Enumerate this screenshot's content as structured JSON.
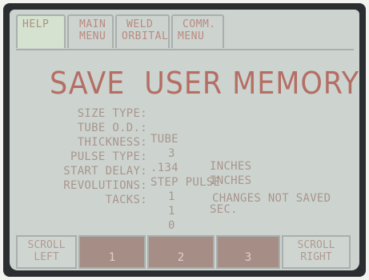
{
  "top_softkeys": [
    {
      "line1": "HELP",
      "line2": ""
    },
    {
      "line1": "MAIN",
      "line2": "MENU"
    },
    {
      "line1": "WELD",
      "line2": "ORBITAL"
    },
    {
      "line1": "COMM.",
      "line2": "MENU"
    }
  ],
  "title": "SAVE  USER MEMORY",
  "parameters": [
    {
      "label": "SIZE TYPE:",
      "value": "TUBE",
      "unit": ""
    },
    {
      "label": "TUBE O.D.:",
      "value": "3",
      "unit": "INCHES"
    },
    {
      "label": "THICKNESS:",
      "value": ".134",
      "unit": "INCHES"
    },
    {
      "label": "PULSE TYPE:",
      "value": "STEP PULSE",
      "unit": ""
    },
    {
      "label": "START DELAY:",
      "value": "1",
      "unit": "SEC."
    },
    {
      "label": "REVOLUTIONS:",
      "value": "1",
      "unit": ""
    },
    {
      "label": "TACKS:",
      "value": "0",
      "unit": ""
    }
  ],
  "status_message": "CHANGES NOT SAVED",
  "bottom_softkeys": [
    {
      "line1": "SCROLL",
      "line2": "LEFT"
    },
    {
      "label": "1"
    },
    {
      "label": "2"
    },
    {
      "label": "3"
    },
    {
      "line1": "SCROLL",
      "line2": "RIGHT"
    }
  ],
  "colors": {
    "screen_bg": "#cdd4d0",
    "text": "#a8958c",
    "title": "#b56e64",
    "active_key": "#a68d86"
  }
}
